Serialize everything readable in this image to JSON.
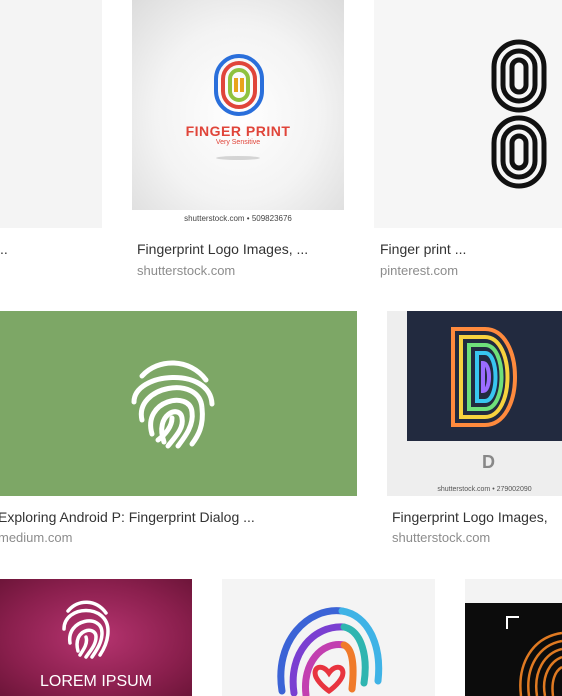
{
  "results": [
    {
      "title": "",
      "caption": "..",
      "source": ""
    },
    {
      "title": "Fingerprint Logo Images, ...",
      "source": "shutterstock.com",
      "logo_text": "FINGER PRINT",
      "logo_subtext": "Very Sensitive",
      "watermark": "shutterstock.com • 509823676",
      "accent": "#e0453a"
    },
    {
      "title": "Finger print ...",
      "source": "pinterest.com"
    },
    {
      "title": "Exploring Android P: Fingerprint Dialog ...",
      "source": "medium.com",
      "background": "#7da766"
    },
    {
      "title": "Fingerprint Logo Images,",
      "source": "shutterstock.com",
      "watermark": "shutterstock.com • 279002090",
      "background": "#222a3f"
    },
    {
      "title": "",
      "source": "",
      "logo_text": "LOREM IPSUM",
      "background": "#8a1f4d"
    },
    {
      "title": "",
      "source": ""
    },
    {
      "title": "",
      "source": ""
    }
  ]
}
